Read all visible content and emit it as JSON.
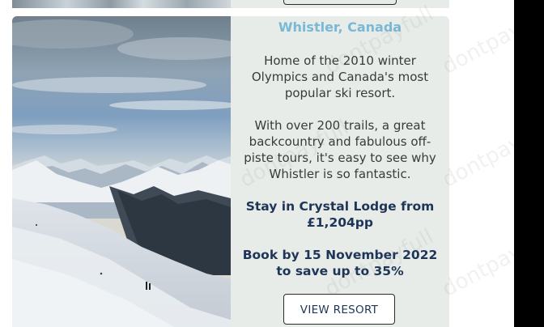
{
  "resort": {
    "name": "Whistler, Canada",
    "intro": "Home of the 2010 winter Olympics and Canada's most popular ski resort.",
    "description": "With over 200 trails, a great backcountry and fabulous off-piste tours, it's easy to see why Whistler is so fantastic.",
    "stay_offer": "Stay in Crystal Lodge from £1,204pp",
    "booking_offer": "Book by 15 November 2022 to save up to 35%",
    "button_label": "VIEW RESORT"
  },
  "watermark": "dontpayfull",
  "colors": {
    "title": "#79b8d6",
    "offer": "#1f3557",
    "card_bg": "#e7ece8"
  }
}
